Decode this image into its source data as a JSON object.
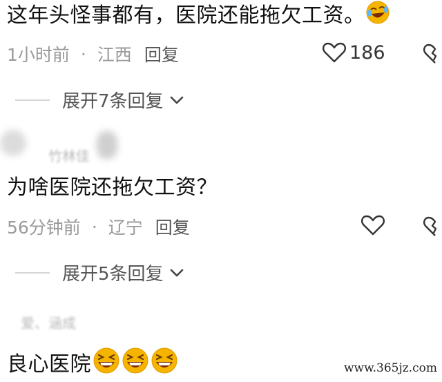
{
  "comments": [
    {
      "text": "这年头怪事都有，医院还能拖欠工资。",
      "emoji": "rolling-laughing-emoji",
      "time": "1小时前",
      "dot": "·",
      "location": "江西",
      "reply_label": "回复",
      "likes": "186",
      "expand_label": "展开7条回复"
    },
    {
      "username": "竹林佳",
      "text": "为啥医院还拖欠工资？",
      "time": "56分钟前",
      "dot": "·",
      "location": "辽宁",
      "reply_label": "回复",
      "expand_label": "展开5条回复"
    },
    {
      "username": "爱、涵成",
      "text": "良心医院",
      "emojis": [
        "grinning-squint-emoji",
        "grinning-squint-emoji",
        "grinning-squint-emoji"
      ]
    }
  ],
  "watermark": "www.365jz.com",
  "colors": {
    "meta": "#9a9a9a",
    "text": "#111111",
    "emoji": "#f5b400"
  }
}
